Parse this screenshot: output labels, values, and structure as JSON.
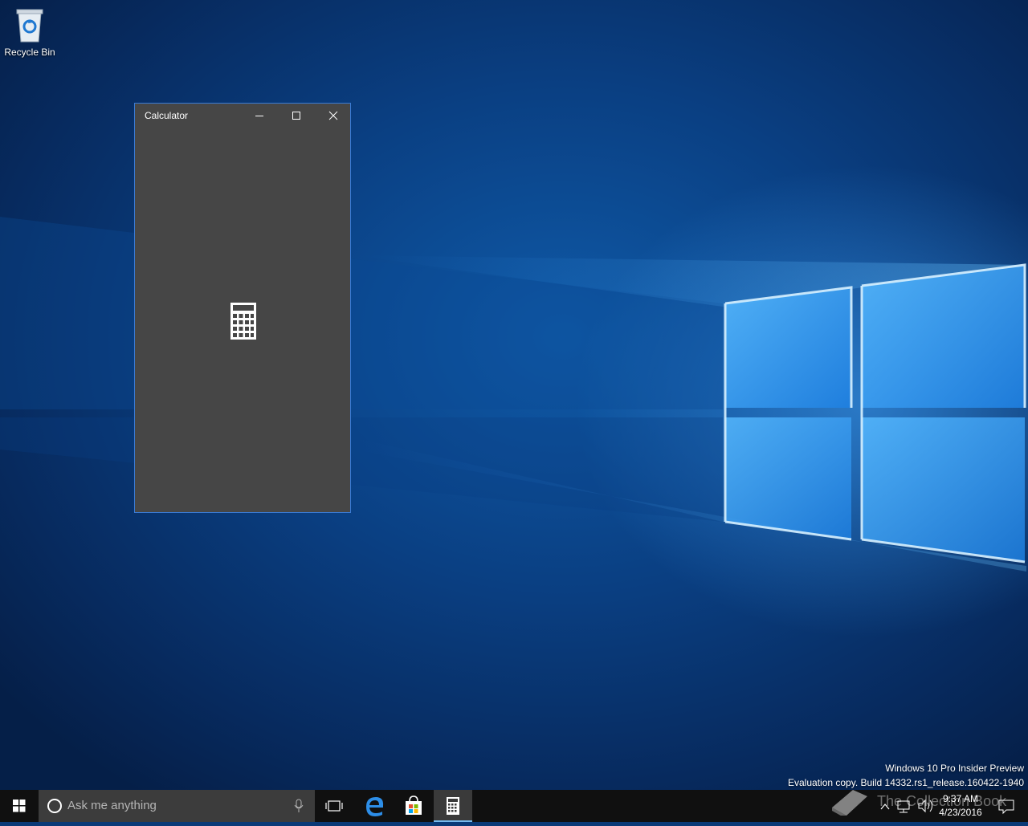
{
  "desktop": {
    "icons": [
      {
        "label": "Recycle Bin"
      }
    ],
    "watermark": {
      "line1": "Windows 10 Pro Insider Preview",
      "line2": "Evaluation copy. Build 14332.rs1_release.160422-1940"
    },
    "overlay_text": "The Collection Book"
  },
  "window": {
    "title": "Calculator",
    "accent": "#3a7bd5",
    "background": "#464646",
    "splash_icon": "calculator-icon"
  },
  "taskbar": {
    "search_placeholder": "Ask me anything",
    "pinned": [
      "task-view-icon",
      "edge-icon",
      "store-icon",
      "calculator-icon"
    ],
    "active_app": "calculator-icon",
    "clock": {
      "time": "9:37 AM",
      "date": "4/23/2016"
    }
  }
}
